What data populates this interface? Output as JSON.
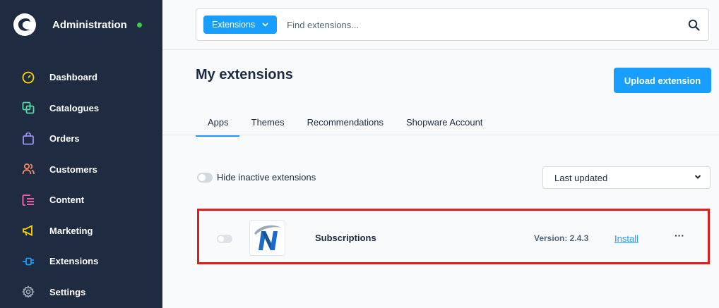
{
  "sidebar": {
    "title": "Administration",
    "status_color": "#37d046",
    "items": [
      {
        "label": "Dashboard",
        "icon": "dashboard-gauge-icon",
        "color": "#ffd700"
      },
      {
        "label": "Catalogues",
        "icon": "catalogue-icon",
        "color": "#57d9a3"
      },
      {
        "label": "Orders",
        "icon": "shopping-bag-icon",
        "color": "#a092f0"
      },
      {
        "label": "Customers",
        "icon": "users-icon",
        "color": "#f88962"
      },
      {
        "label": "Content",
        "icon": "content-list-icon",
        "color": "#ff68b4"
      },
      {
        "label": "Marketing",
        "icon": "megaphone-icon",
        "color": "#ffd700"
      },
      {
        "label": "Extensions",
        "icon": "plug-icon",
        "color": "#189eff"
      },
      {
        "label": "Settings",
        "icon": "gear-icon",
        "color": "#9aa8b5"
      }
    ]
  },
  "search": {
    "type_label": "Extensions",
    "placeholder": "Find extensions..."
  },
  "page": {
    "title": "My extensions",
    "upload_label": "Upload extension"
  },
  "tabs": [
    "Apps",
    "Themes",
    "Recommendations",
    "Shopware Account"
  ],
  "filters": {
    "hide_inactive_label": "Hide inactive extensions",
    "sort_value": "Last updated"
  },
  "extension": {
    "name": "Subscriptions",
    "version": "Version: 2.4.3",
    "install_label": "Install",
    "more_label": "···"
  },
  "colors": {
    "accent": "#189eff",
    "highlight": "#e21b1b",
    "sidebar_bg": "#1e2b40"
  }
}
